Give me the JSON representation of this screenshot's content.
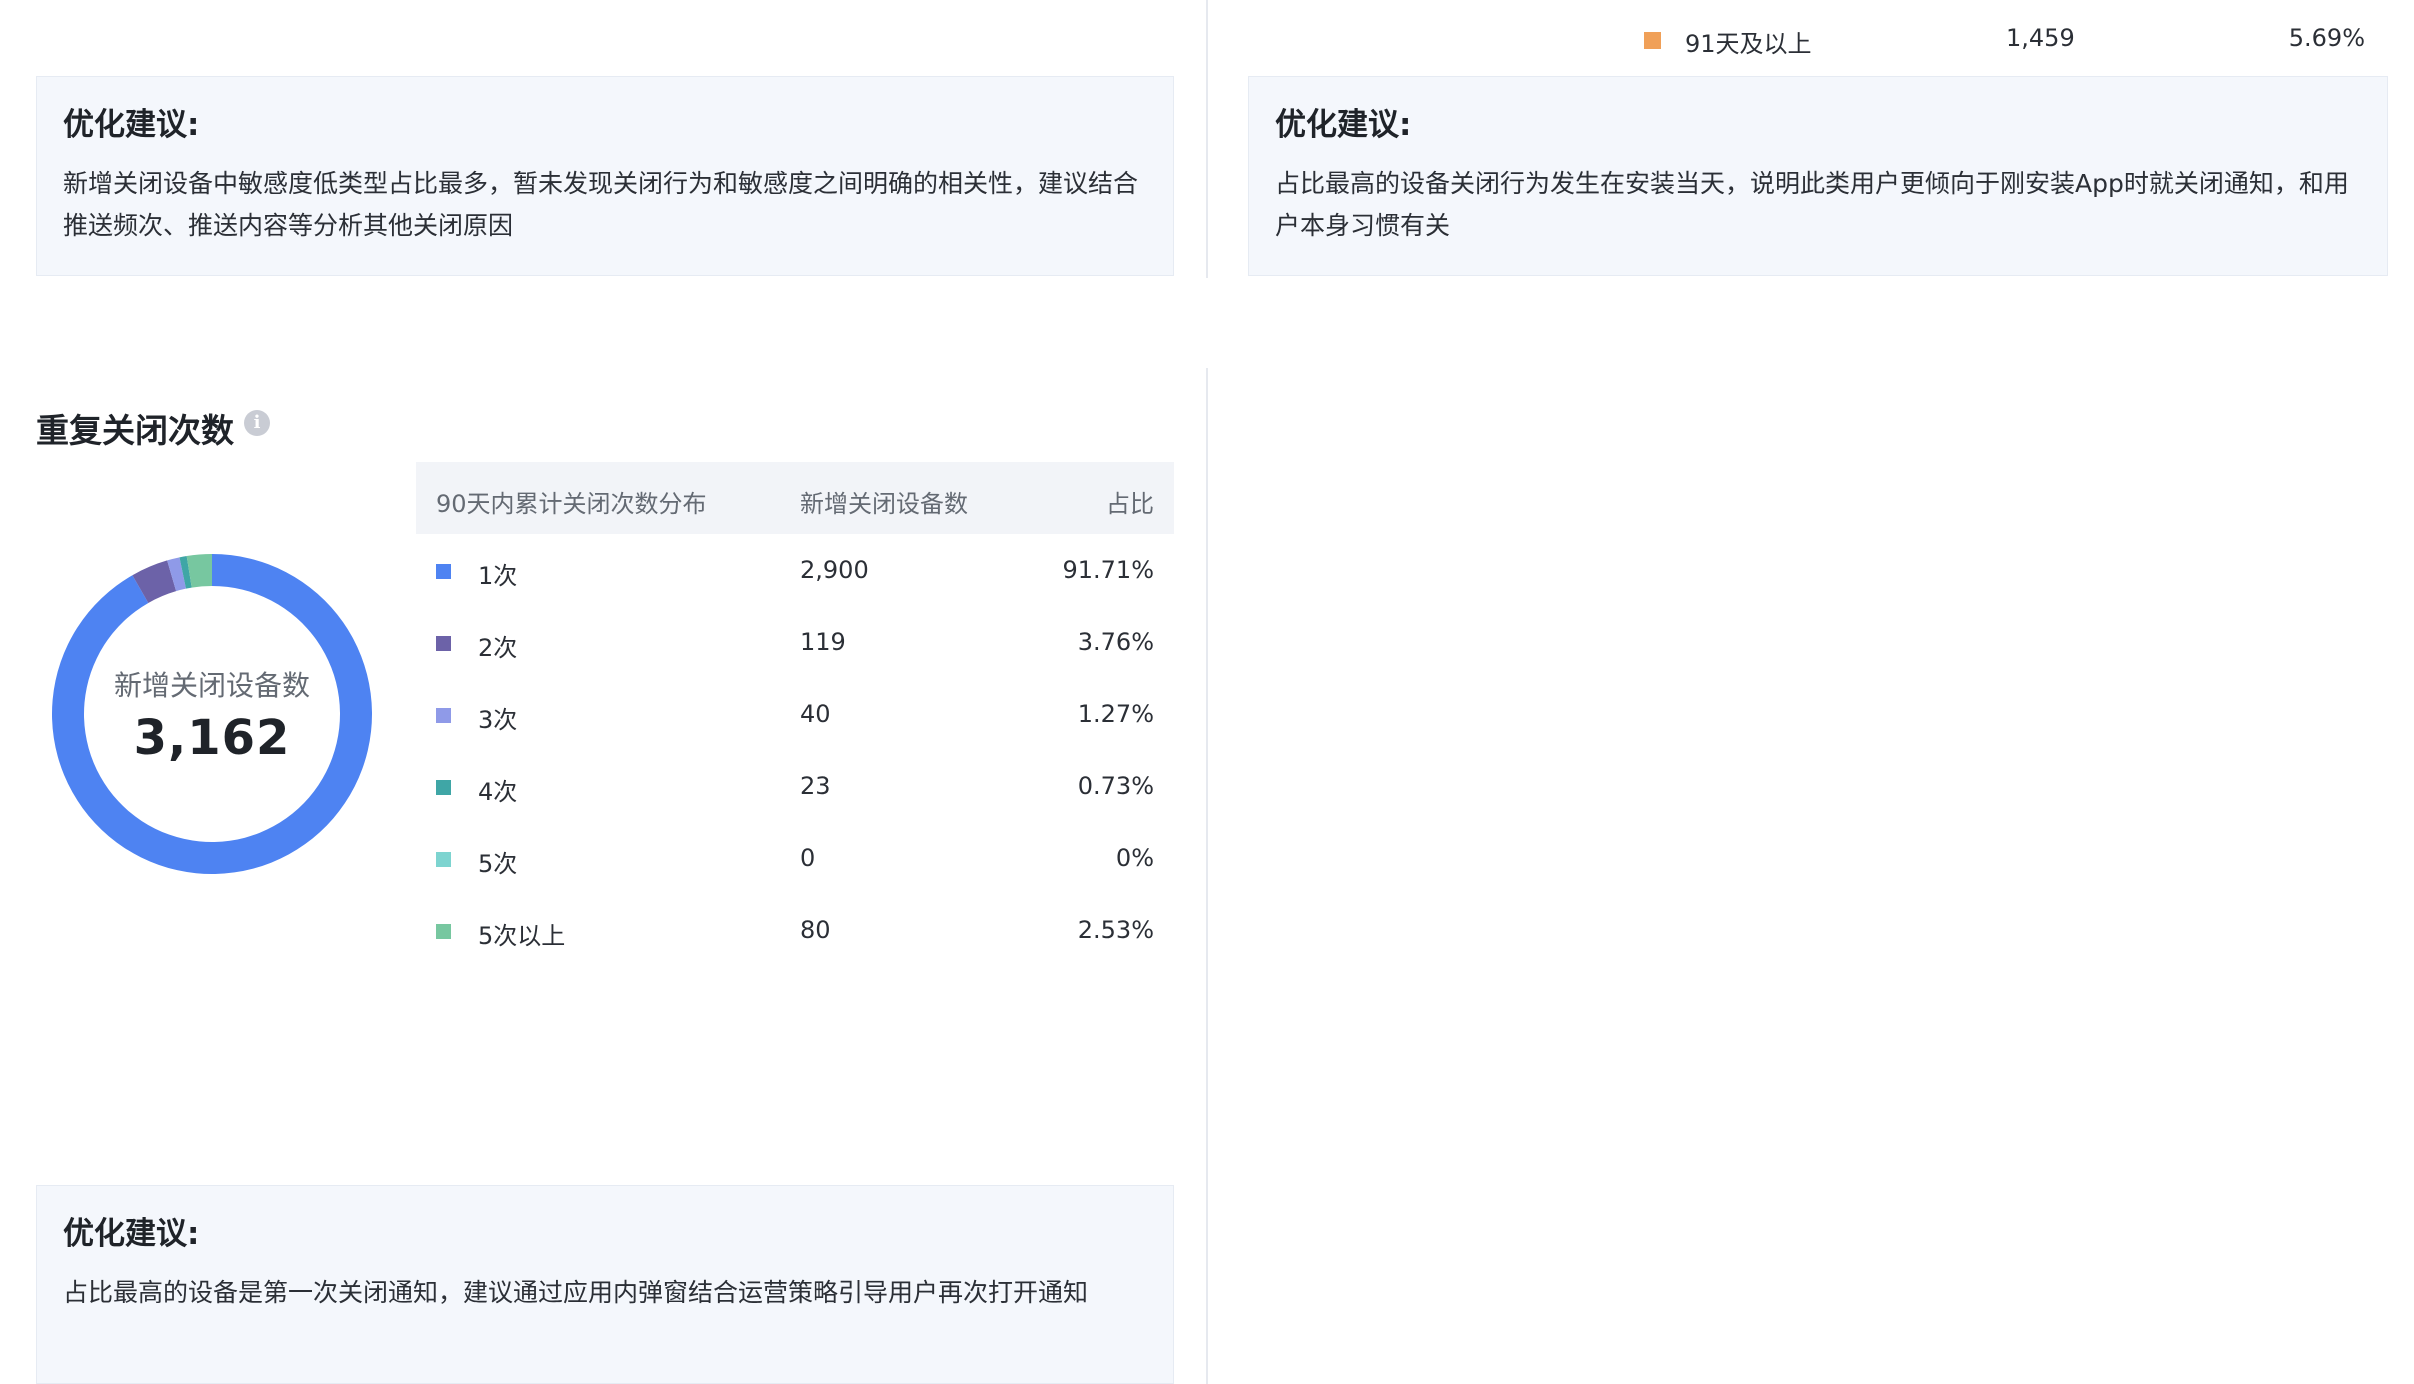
{
  "top_legend_row": {
    "label": "91天及以上",
    "count": "1,459",
    "percent": "5.69%",
    "color": "#f0a058"
  },
  "suggestion_left_top": {
    "title": "优化建议:",
    "text": "新增关闭设备中敏感度低类型占比最多，暂未发现关闭行为和敏感度之间明确的相关性，建议结合推送频次、推送内容等分析其他关闭原因"
  },
  "suggestion_right_top": {
    "title": "优化建议:",
    "text": "占比最高的设备关闭行为发生在安装当天，说明此类用户更倾向于刚安装App时就关闭通知，和用户本身习惯有关"
  },
  "repeat_section": {
    "title": "重复关闭次数",
    "info_icon": "info-icon",
    "donut_label": "新增关闭设备数",
    "donut_total": "3,162",
    "table_headers": [
      "90天内累计关闭次数分布",
      "新增关闭设备数",
      "占比"
    ]
  },
  "chart_data": {
    "type": "pie",
    "center_label": "新增关闭设备数",
    "center_value": 3162,
    "categories": [
      "1次",
      "2次",
      "3次",
      "4次",
      "5次",
      "5次以上"
    ],
    "values": [
      2900,
      119,
      40,
      23,
      0,
      80
    ],
    "percent_labels": [
      "91.71%",
      "3.76%",
      "1.27%",
      "0.73%",
      "0%",
      "2.53%"
    ],
    "colors": [
      "#4e83f2",
      "#6c62a8",
      "#8f9ae8",
      "#3fa6a6",
      "#7dd4d0",
      "#77c7a0"
    ]
  },
  "suggestion_bottom": {
    "title": "优化建议:",
    "text": "占比最高的设备是第一次关闭通知，建议通过应用内弹窗结合运营策略引导用户再次打开通知"
  }
}
